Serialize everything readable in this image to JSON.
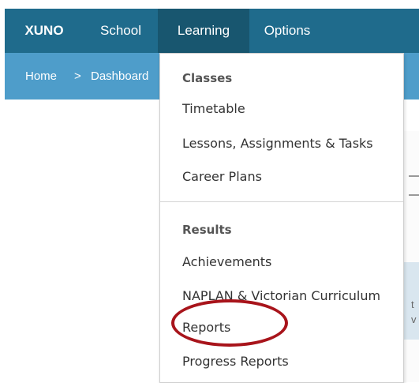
{
  "topnav": {
    "brand": "XUNO",
    "items": [
      "School",
      "Learning",
      "Options"
    ]
  },
  "breadcrumb": {
    "home": "Home",
    "separator": ">",
    "current": "Dashboard"
  },
  "dropdown": {
    "sections": [
      {
        "heading": "Classes",
        "items": [
          "Timetable",
          "Lessons, Assignments & Tasks",
          "Career Plans"
        ]
      },
      {
        "heading": "Results",
        "items": [
          "Achievements",
          "NAPLAN & Victorian Curriculum",
          "Reports",
          "Progress Reports"
        ]
      }
    ],
    "highlighted_item": "Reports"
  },
  "background_text": {
    "line1": "t",
    "line2": "v"
  },
  "colors": {
    "nav_bg": "#1f6b8c",
    "nav_active_bg": "#18566f",
    "breadcrumb_bg": "#4e9dca",
    "highlight_ring": "#a8141b"
  }
}
